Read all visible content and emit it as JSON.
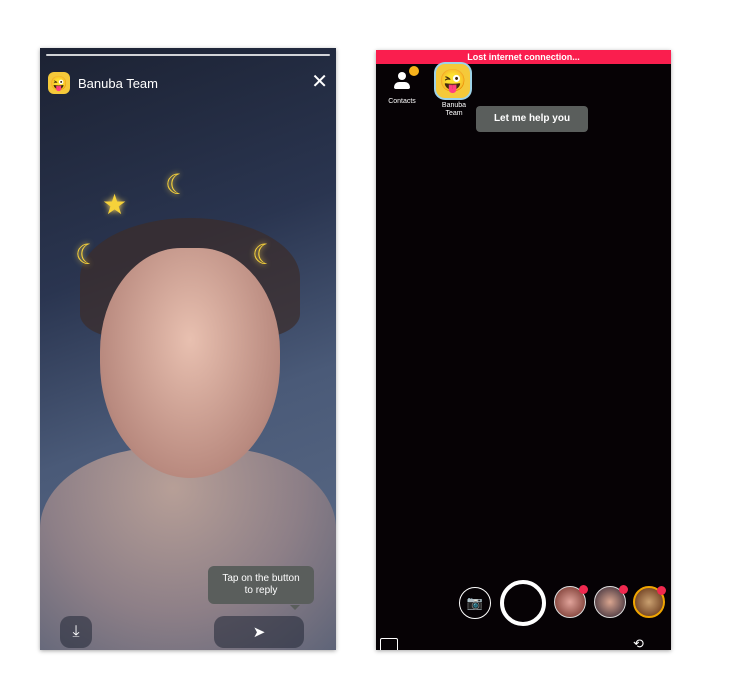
{
  "story": {
    "title": "Banuba Team",
    "tooltip": "Tap on the button to reply",
    "icons": [
      "emoji-avatar-icon",
      "close-icon",
      "download-icon",
      "send-icon"
    ],
    "progress": 1.0
  },
  "camera": {
    "banner": "Lost internet connection...",
    "banner_color": "#fa1e4e",
    "contacts_label": "Contacts",
    "banuba_label": "Banuba Team",
    "tooltip": "Let me help you",
    "icons": [
      "contacts-icon",
      "camera-icon",
      "shutter-button",
      "gallery-icon",
      "flip-camera-icon"
    ],
    "masks": [
      "mask-cat",
      "mask-girl",
      "mask-crown"
    ]
  }
}
